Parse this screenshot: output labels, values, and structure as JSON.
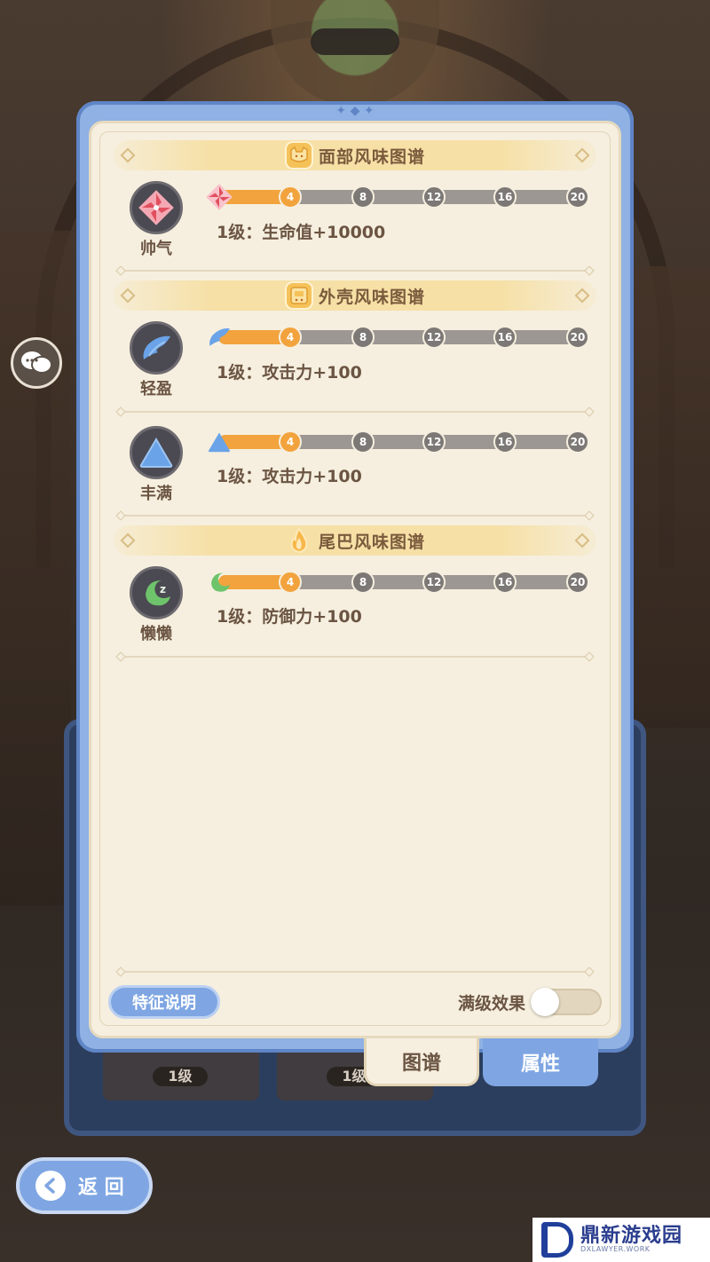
{
  "sections": [
    {
      "title": "面部风味图谱",
      "icon": "cat-face-icon",
      "traits": [
        {
          "name": "帅气",
          "effect": "1级：生命值+10000",
          "icon": "pinwheel-icon",
          "progress_level": 4
        }
      ]
    },
    {
      "title": "外壳风味图谱",
      "icon": "shell-icon",
      "traits": [
        {
          "name": "轻盈",
          "effect": "1级：攻击力+100",
          "icon": "wing-icon",
          "progress_level": 4
        },
        {
          "name": "丰满",
          "effect": "1级：攻击力+100",
          "icon": "triangle-icon",
          "progress_level": 4
        }
      ]
    },
    {
      "title": "尾巴风味图谱",
      "icon": "flame-icon",
      "traits": [
        {
          "name": "懒懒",
          "effect": "1级：防御力+100",
          "icon": "sleeping-moon-icon",
          "progress_level": 4
        }
      ]
    }
  ],
  "milestones": [
    "4",
    "8",
    "12",
    "16",
    "20"
  ],
  "footer": {
    "feature_button": "特征说明",
    "max_effect_label": "满级效果",
    "max_effect_on": false
  },
  "tabs": {
    "atlas": "图谱",
    "attributes": "属性"
  },
  "back_button": "返 回",
  "background_slots": [
    "1级",
    "1级"
  ],
  "watermark": {
    "cn": "鼎新游戏园",
    "en": "DXLAWYER.WORK"
  },
  "colors": {
    "accent_blue": "#7fa6e3",
    "progress_orange": "#f2a33d",
    "panel_cream": "#f6efdf"
  }
}
